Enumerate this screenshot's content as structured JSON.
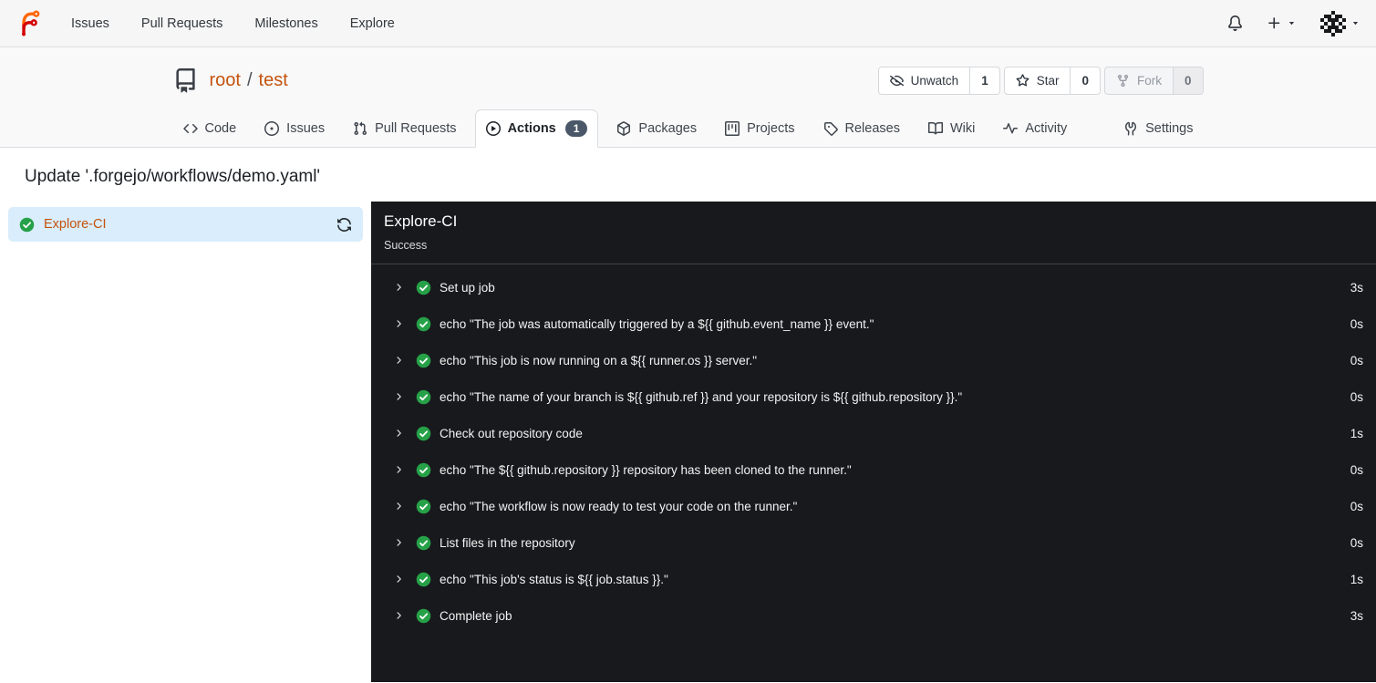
{
  "colors": {
    "accent_link": "#c4530d",
    "success_green": "#26a148",
    "panel_bg": "#18191d",
    "selected_job_bg": "#d9edfc",
    "tab_badge_bg": "#4a5768",
    "header_bg": "#f9f9fa"
  },
  "navbar": {
    "brand_icon": "forgejo-logo",
    "items": [
      {
        "label": "Issues"
      },
      {
        "label": "Pull Requests"
      },
      {
        "label": "Milestones"
      },
      {
        "label": "Explore"
      }
    ],
    "right_icons": [
      "bell-icon",
      "plus-icon",
      "user-avatar-identicon"
    ]
  },
  "repo": {
    "icon": "repo-book-icon",
    "owner": "root",
    "separator": "/",
    "name": "test",
    "buttons": {
      "unwatch": {
        "icon": "eye-off-icon",
        "label": "Unwatch",
        "count": "1"
      },
      "star": {
        "icon": "star-icon",
        "label": "Star",
        "count": "0"
      },
      "fork": {
        "icon": "fork-icon",
        "label": "Fork",
        "count": "0",
        "disabled": true
      }
    },
    "tabs": [
      {
        "label": "Code",
        "icon": "code-icon"
      },
      {
        "label": "Issues",
        "icon": "issue-opened-icon"
      },
      {
        "label": "Pull Requests",
        "icon": "git-pull-request-icon"
      },
      {
        "label": "Actions",
        "icon": "play-circle-icon",
        "badge": "1",
        "active": true
      },
      {
        "label": "Packages",
        "icon": "package-icon"
      },
      {
        "label": "Projects",
        "icon": "project-board-icon"
      },
      {
        "label": "Releases",
        "icon": "tag-icon"
      },
      {
        "label": "Wiki",
        "icon": "book-icon"
      },
      {
        "label": "Activity",
        "icon": "pulse-icon"
      },
      {
        "label": "Settings",
        "icon": "tools-icon"
      }
    ]
  },
  "run": {
    "title": "Update '.forgejo/workflows/demo.yaml'",
    "sidebar_job": {
      "name": "Explore-CI",
      "status_icon": "check-circle-icon",
      "rerun_icon": "sync-icon"
    },
    "panel": {
      "job_name": "Explore-CI",
      "status": "Success"
    },
    "steps": [
      {
        "name": "Set up job",
        "duration": "3s"
      },
      {
        "name": "echo \"The job was automatically triggered by a ${{ github.event_name }} event.\"",
        "duration": "0s"
      },
      {
        "name": "echo \"This job is now running on a ${{ runner.os }} server.\"",
        "duration": "0s"
      },
      {
        "name": "echo \"The name of your branch is ${{ github.ref }} and your repository is ${{ github.repository }}.\"",
        "duration": "0s"
      },
      {
        "name": "Check out repository code",
        "duration": "1s"
      },
      {
        "name": "echo \"The ${{ github.repository }} repository has been cloned to the runner.\"",
        "duration": "0s"
      },
      {
        "name": "echo \"The workflow is now ready to test your code on the runner.\"",
        "duration": "0s"
      },
      {
        "name": "List files in the repository",
        "duration": "0s"
      },
      {
        "name": "echo \"This job's status is ${{ job.status }}.\"",
        "duration": "1s"
      },
      {
        "name": "Complete job",
        "duration": "3s"
      }
    ]
  }
}
